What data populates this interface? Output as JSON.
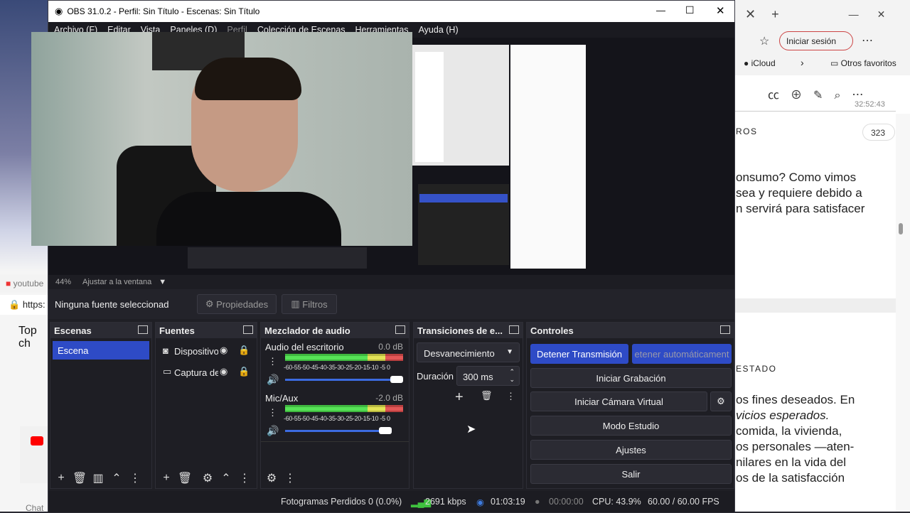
{
  "obs": {
    "title": "OBS 31.0.2 - Perfil: Sin Título - Escenas: Sin Título",
    "menu": [
      "Archivo (F)",
      "Editar",
      "Vista",
      "Paneles (D)",
      "Perfil",
      "Colección de Escenas",
      "Herramientas",
      "Ayuda (H)"
    ],
    "zoom": "44%",
    "zoom_mode": "Ajustar a la ventana",
    "no_source": "Ninguna fuente seleccionad",
    "properties_label": "Propiedades",
    "filters_label": "Filtros",
    "scenes": {
      "title": "Escenas",
      "items": [
        "Escena"
      ]
    },
    "sources": {
      "title": "Fuentes",
      "items": [
        "Dispositivo",
        "Captura de"
      ]
    },
    "mixer": {
      "title": "Mezclador de audio",
      "channels": [
        {
          "name": "Audio del escritorio",
          "db": "0.0 dB",
          "level": 0.95
        },
        {
          "name": "Mic/Aux",
          "db": "-2.0 dB",
          "level": 0.85
        }
      ],
      "scale": "-60-55-50-45-40-35-30-25-20-15-10 -5  0"
    },
    "transitions": {
      "title": "Transiciones de e...",
      "selected": "Desvanecimiento",
      "duration_label": "Duración",
      "duration": "300 ms"
    },
    "controls": {
      "title": "Controles",
      "stop_stream": "Detener Transmisión",
      "auto_stop": "etener automáticament",
      "start_rec": "Iniciar Grabación",
      "virtual_cam": "Iniciar Cámara Virtual",
      "studio": "Modo Estudio",
      "settings": "Ajustes",
      "exit": "Salir"
    },
    "status": {
      "dropped": "Fotogramas Perdidos 0 (0.0%)",
      "bitrate": "2691 kbps",
      "stream_time": "01:03:19",
      "rec_time": "00:00:00",
      "cpu": "CPU: 43.9%",
      "fps": "60.00 / 60.00 FPS"
    }
  },
  "browser": {
    "signin": "Iniciar sesión",
    "bookmark1": "iCloud",
    "bookmark2": "Otros favoritos",
    "time": "32:52:43",
    "page_num": "323",
    "lines": [
      "ROS",
      "onsumo? Como vimos",
      "sea y requiere debido a",
      "n servirá para satisfacer",
      "ESTADO",
      "os fines deseados. En",
      "vicios esperados.",
      "comida, la vivienda,",
      "os personales —aten-",
      "nilares en la vida del",
      "os de la satisfacción"
    ]
  },
  "left_browser": {
    "tab": "youtube",
    "url": "https:",
    "heading": "Top ch",
    "chat": "Chat"
  }
}
